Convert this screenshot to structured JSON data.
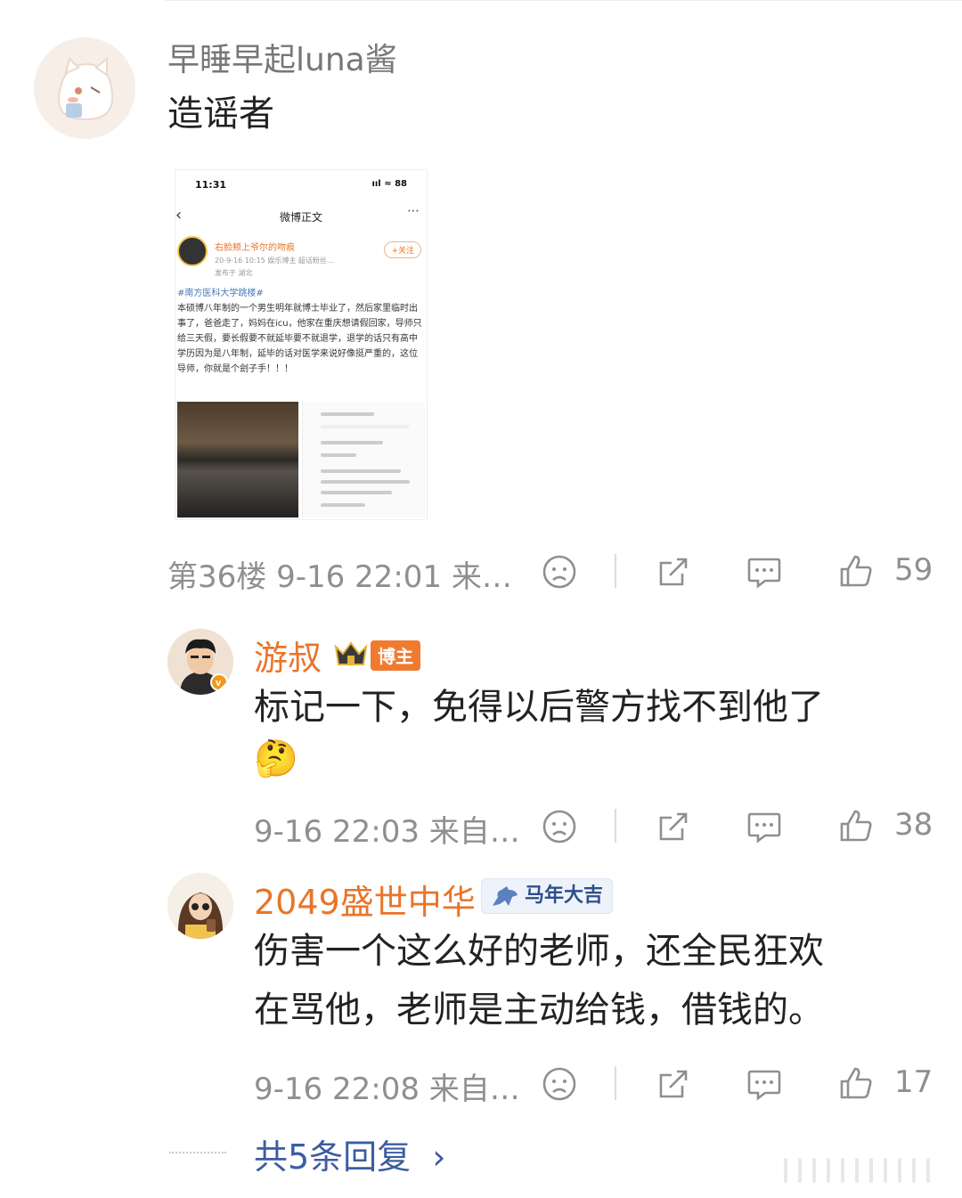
{
  "main_comment": {
    "username": "早睡早起luna酱",
    "text": "造谣者",
    "floor": "第36楼",
    "time": "9-16 22:01",
    "source": "来…",
    "likes": "59"
  },
  "embedded_screenshot": {
    "status_time": "11:31",
    "status_right": "ııl ≈ 88",
    "nav_title": "微博正文",
    "poster_name": "右脸颊上爷尔的吻痕",
    "poster_meta": "20-9-16 10:15  娱乐博主 超话粉丝…",
    "poster_location": "发布于 湖北",
    "follow_label": "+关注",
    "post_hashtag": "#南方医科大学跳楼#",
    "post_body": "本硕博八年制的一个男生明年就博士毕业了，然后家里临时出事了，爸爸走了，妈妈在icu，他家在重庆想请假回家，导师只给三天假，要长假要不就延毕要不就退学，退学的话只有高中学历因为是八年制，延毕的话对医学来说好像挺严重的，这位导师，你就是个刽子手！！！"
  },
  "replies": [
    {
      "username": "游叔",
      "badge_label": "博主",
      "text_line1": "标记一下，免得以后警方找不到他了",
      "emoji": "🤔",
      "time": "9-16 22:03",
      "source": "来自…",
      "likes": "38"
    },
    {
      "username": "2049盛世中华",
      "badge_label": "马年大吉",
      "text_line1": "伤害一个这么好的老师，还全民狂欢",
      "text_line2": "在骂他，老师是主动给钱，借钱的。",
      "time": "9-16 22:08",
      "source": "来自…",
      "likes": "17"
    }
  ],
  "more_replies": {
    "label": "共5条回复",
    "chevron": "›"
  },
  "colors": {
    "username_main": "#777777",
    "username_reply": "#e8752a",
    "link": "#3c5da0",
    "meta": "#8f8f8f"
  }
}
